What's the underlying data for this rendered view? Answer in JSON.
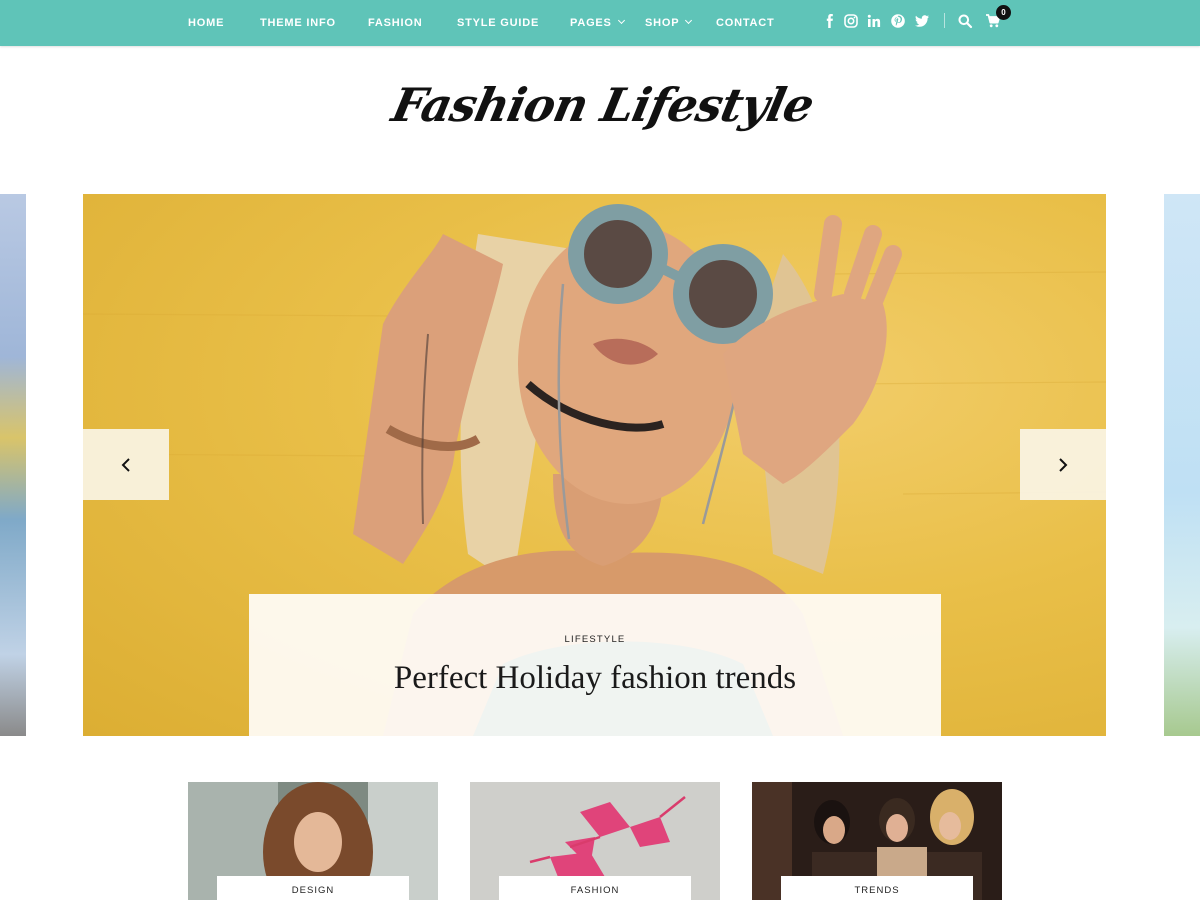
{
  "nav": {
    "items": [
      {
        "label": "HOME"
      },
      {
        "label": "THEME INFO"
      },
      {
        "label": "FASHION"
      },
      {
        "label": "STYLE GUIDE"
      },
      {
        "label": "PAGES"
      },
      {
        "label": "SHOP"
      },
      {
        "label": "CONTACT"
      }
    ],
    "social_icons": [
      "facebook-icon",
      "instagram-icon",
      "linkedin-icon",
      "pinterest-icon",
      "twitter-icon"
    ],
    "cart_count": "0",
    "bar_color": "#5fc4b8"
  },
  "site": {
    "logo_text": "Fashion Lifestyle"
  },
  "slider": {
    "category": "LIFESTYLE",
    "title": "Perfect Holiday fashion trends"
  },
  "cards": [
    {
      "category": "DESIGN"
    },
    {
      "category": "FASHION"
    },
    {
      "category": "TRENDS"
    }
  ]
}
